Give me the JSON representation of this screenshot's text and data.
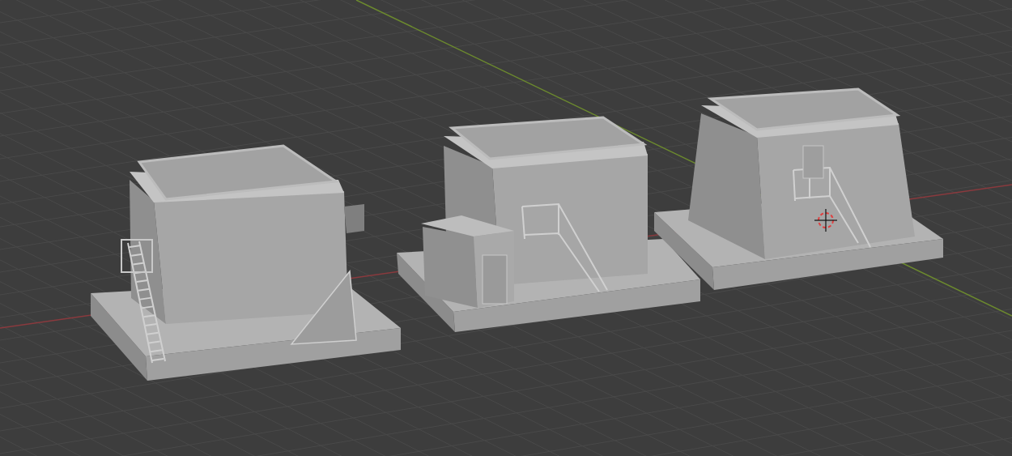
{
  "viewport": {
    "objects": [
      {
        "kind": "ladder"
      },
      {
        "kind": "annex"
      },
      {
        "kind": "stairs"
      }
    ]
  }
}
